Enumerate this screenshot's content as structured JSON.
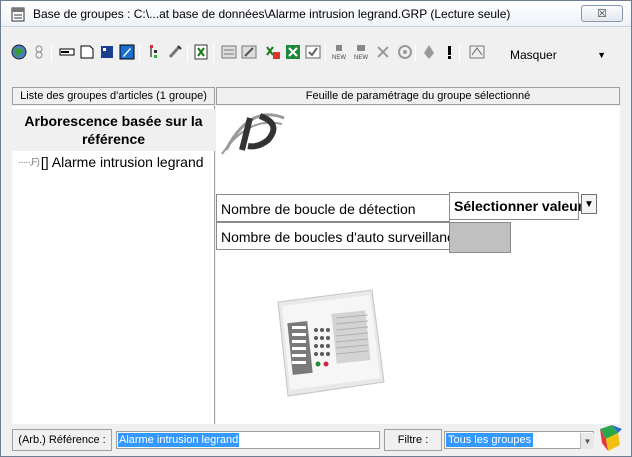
{
  "window": {
    "title": "Base de groupes : C:\\...at base de données\\Alarme intrusion legrand.GRP (Lecture seule)",
    "close_label": "☒"
  },
  "toolbar": {
    "icons": [
      "globe-icon",
      "toggle-icon",
      "field-icon",
      "page-icon",
      "grid-icon",
      "edit-icon",
      "tree-icon",
      "tools-icon",
      "excel-icon",
      "form-icon",
      "grid-edit-icon",
      "excel-edit-icon",
      "excel-green-icon",
      "check-list-icon",
      "new-icon",
      "new-copy-icon",
      "delete-icon",
      "settings-icon",
      "alert-icon",
      "exclamation-icon",
      "hide-icon"
    ],
    "mask_combo_value": "Masquer"
  },
  "left_panel": {
    "header": "Liste des groupes d'articles (1 groupe)",
    "tree_title": "Arborescence basée sur la référence",
    "tree_item": "[] Alarme intrusion legrand"
  },
  "right_panel": {
    "header": "Feuille de paramétrage du groupe sélectionné",
    "rows": [
      {
        "label": "Nombre de boucle de détection",
        "value": "Sélectionner valeur"
      },
      {
        "label": "Nombre de boucles d'auto surveillance",
        "value": ""
      }
    ]
  },
  "bottom_bar": {
    "reference_label": "(Arb.) Référence :",
    "reference_value": "Alarme intrusion legrand",
    "filter_label": "Filtre :",
    "filter_value": "Tous les groupes"
  },
  "colors": {
    "selection": "#3399ff",
    "window_bg": "#f0f0f0",
    "panel_bg": "#ffffff",
    "empty_cell": "#c0c0c0"
  }
}
